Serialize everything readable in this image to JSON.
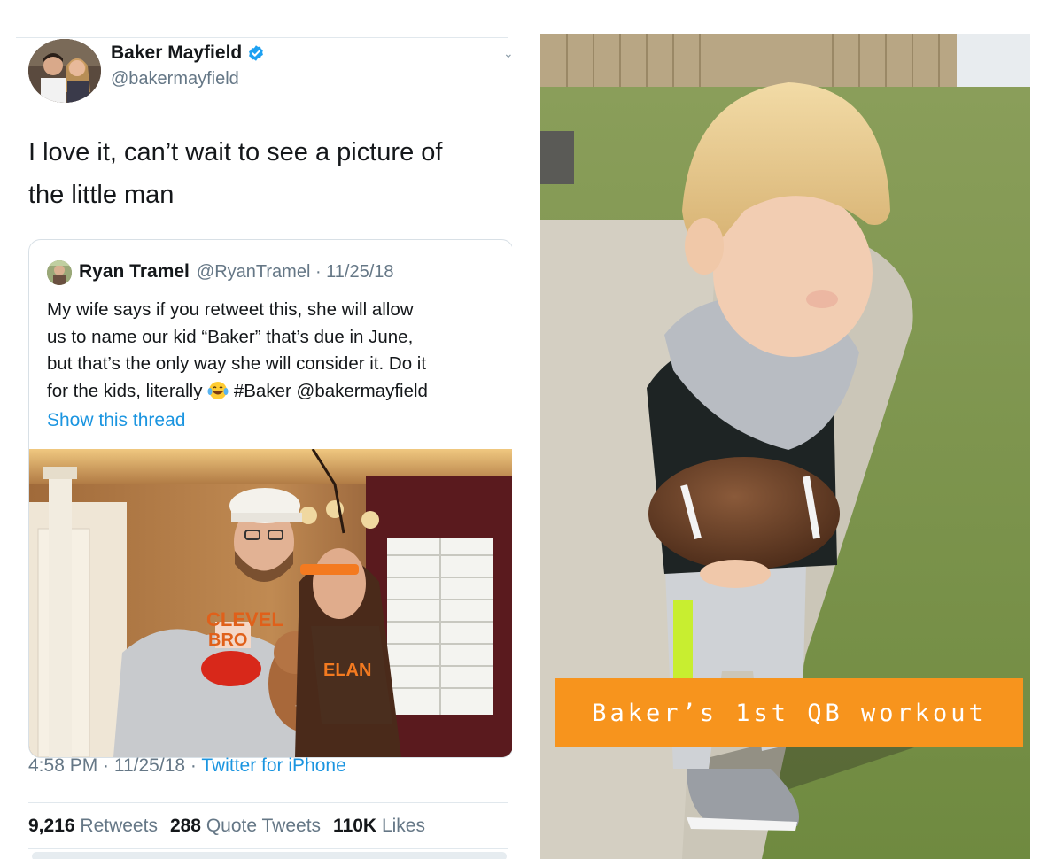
{
  "tweet": {
    "author": {
      "display_name": "Baker Mayfield",
      "handle": "@bakermayfield",
      "verified": true
    },
    "text_line1": "I love it, can’t wait to see a picture of",
    "text_line2": "the little man",
    "quoted_tweet": {
      "author_name": "Ryan Tramel",
      "handle_and_date": "@RyanTramel · 11/25/18",
      "line1": "My wife says if you retweet this, she will allow",
      "line2": "us to name our kid “Baker” that’s due in June,",
      "line3": "but that’s the only way she will consider it. Do it",
      "line4_pre": "for the kids, literally",
      "line4_post": "#Baker @bakermayfield",
      "show_thread": "Show this thread"
    },
    "time": "4:58 PM · 11/25/18 · ",
    "source": "Twitter for iPhone",
    "stats": {
      "retweets_count": "9,216",
      "retweets_label": "Retweets",
      "quotes_count": "288",
      "quotes_label": "Quote Tweets",
      "likes_count": "110K",
      "likes_label": "Likes"
    }
  },
  "photo": {
    "caption": "Baker’s 1st QB workout",
    "caption_color": "#f7941d"
  },
  "colors": {
    "link": "#1b95e0",
    "secondary_text": "#657786",
    "verified": "#1da1f2"
  }
}
